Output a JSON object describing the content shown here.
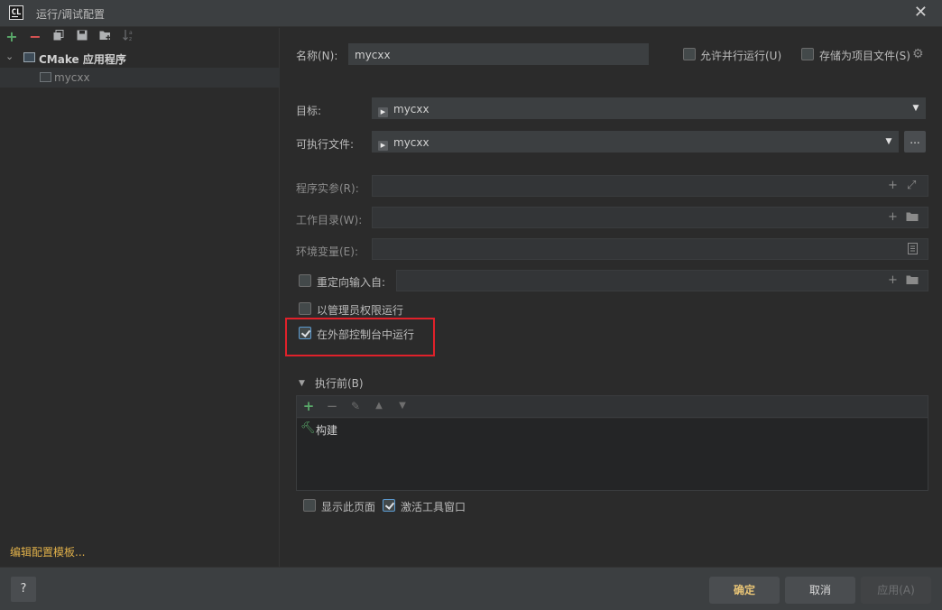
{
  "window": {
    "app_icon_text": "CL",
    "title": "运行/调试配置"
  },
  "left": {
    "tree": [
      {
        "label": "CMake 应用程序"
      },
      {
        "label": "mycxx"
      }
    ],
    "edit_templates": "编辑配置模板..."
  },
  "form": {
    "name_label": "名称(N):",
    "name_value": "mycxx",
    "allow_parallel_label": "允许并行运行(U)",
    "store_as_project_file_label": "存储为项目文件(S)",
    "target_label": "目标:",
    "target_value": "mycxx",
    "executable_label": "可执行文件:",
    "executable_value": "mycxx",
    "executable_browse": "...",
    "program_args_label": "程序实参(R):",
    "working_dir_label": "工作目录(W):",
    "env_vars_label": "环境变量(E):",
    "redirect_input_label": "重定向输入自:",
    "run_as_admin_label": "以管理员权限运行",
    "run_in_external_console_label": "在外部控制台中运行",
    "before_launch_label": "执行前(B)",
    "before_launch_items": [
      "构建"
    ],
    "show_page_label": "显示此页面",
    "activate_tool_window_label": "激活工具窗口"
  },
  "state": {
    "allow_parallel": false,
    "store_as_project_file": false,
    "redirect_input": false,
    "run_as_admin": false,
    "run_in_external_console": true,
    "show_page": false,
    "activate_tool_window": true
  },
  "buttons": {
    "help": "?",
    "ok": "确定",
    "cancel": "取消",
    "apply": "应用(A)"
  },
  "colors": {
    "add": "#59a869",
    "remove": "#e05555",
    "highlight_box": "#e0212a",
    "link": "#e0b04a"
  }
}
